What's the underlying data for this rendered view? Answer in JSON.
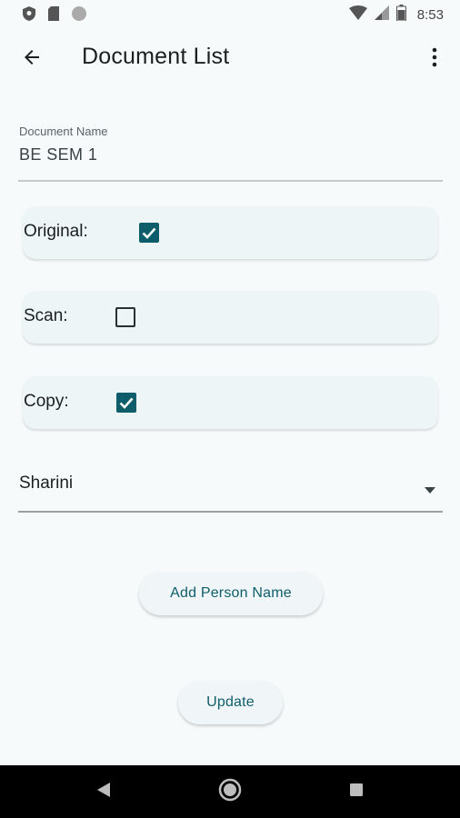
{
  "status_bar": {
    "time": "8:53",
    "left_icons": [
      "shield-icon",
      "sd-card-icon",
      "circle-icon"
    ],
    "right_icons": [
      "wifi-icon",
      "signal-icon",
      "battery-icon"
    ]
  },
  "app_bar": {
    "title": "Document List",
    "back_icon": "arrow-left-icon",
    "more_icon": "more-vertical-icon"
  },
  "document_name": {
    "label": "Document Name",
    "value": "BE SEM 1"
  },
  "checkboxes": [
    {
      "label": "Original:",
      "checked": true
    },
    {
      "label": "Scan:",
      "checked": false
    },
    {
      "label": "Copy:",
      "checked": true
    }
  ],
  "person_dropdown": {
    "selected": "Sharini",
    "icon": "caret-down-icon"
  },
  "buttons": {
    "add_person": "Add Person Name",
    "update": "Update"
  },
  "nav_bar": {
    "icons": [
      "back-triangle-icon",
      "home-circle-icon",
      "recents-square-icon"
    ]
  },
  "colors": {
    "accent": "#0d5d6b",
    "background": "#f6fafa",
    "card": "#eef5f6"
  }
}
